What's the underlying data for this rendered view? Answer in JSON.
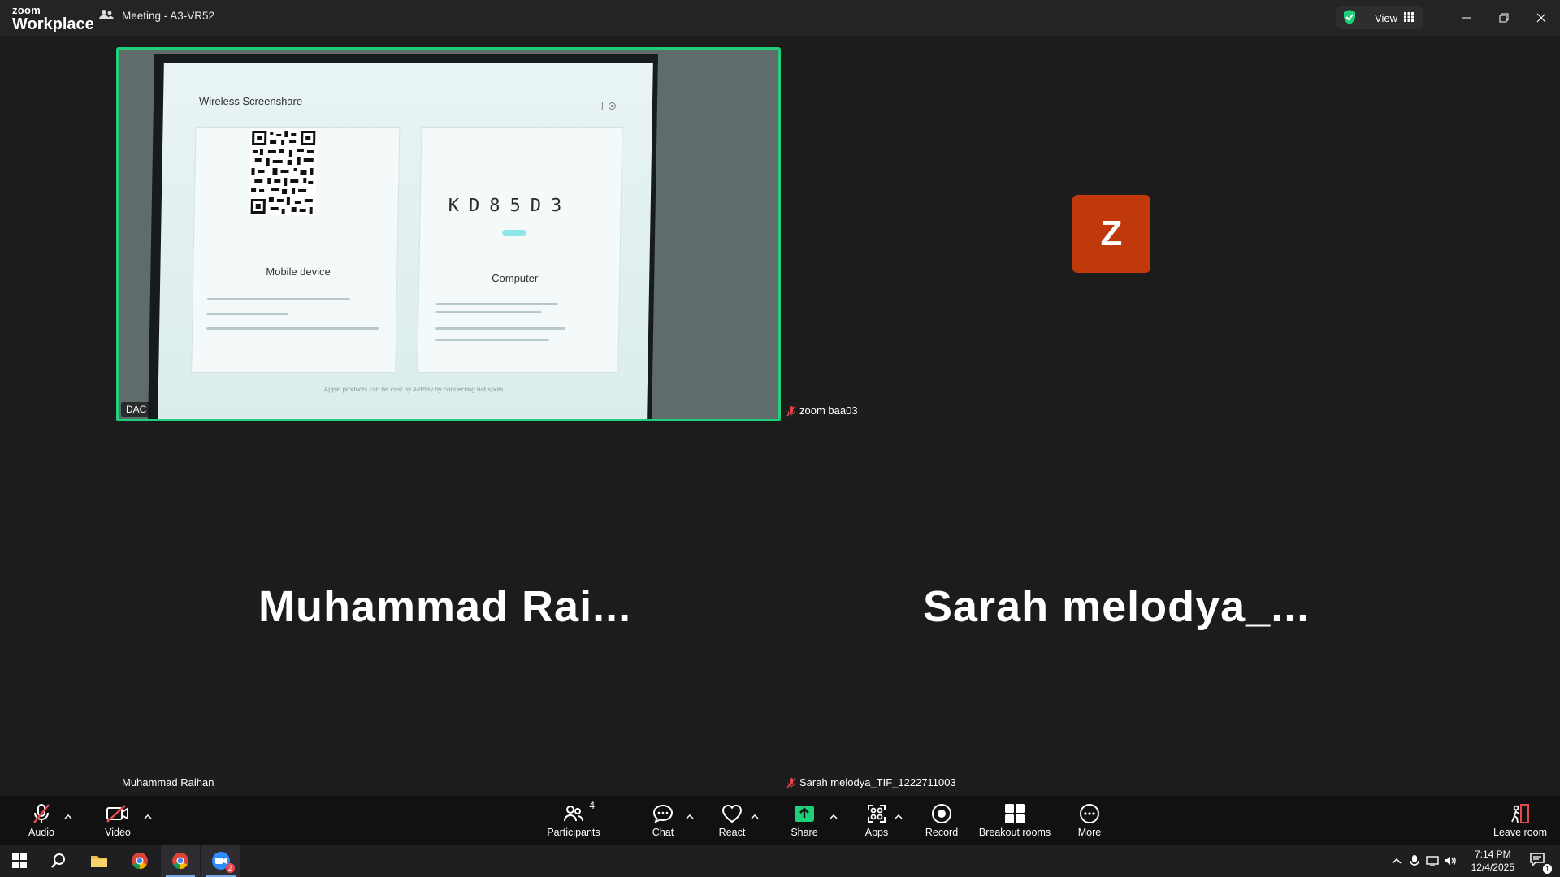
{
  "titlebar": {
    "brand_top": "zoom",
    "brand_bottom": "Workplace",
    "meeting_title": "Meeting - A3-VR52",
    "view_label": "View"
  },
  "video": {
    "participant_label": "DAC",
    "screen": {
      "title": "Wireless Screenshare",
      "code": "KD85D3",
      "mobile_label": "Mobile device",
      "computer_label": "Computer",
      "bottom_note": "Apple products can be cast by AirPlay by connecting hot spots"
    }
  },
  "participants": {
    "zoom_tag": "zoom baa03",
    "avatar_letter": "Z",
    "raihan_big": "Muhammad  Rai...",
    "sarah_big": "Sarah  melodya_...",
    "raihan_tag": "Muhammad Raihan",
    "sarah_tag": "Sarah melodya_TIF_1222711003"
  },
  "toolbar": {
    "audio": "Audio",
    "video": "Video",
    "participants": "Participants",
    "participants_count": "4",
    "chat": "Chat",
    "react": "React",
    "share": "Share",
    "apps": "Apps",
    "record": "Record",
    "breakout": "Breakout rooms",
    "more": "More",
    "leave": "Leave room"
  },
  "taskbar": {
    "time": "7:14 PM",
    "date": "12/4/2025",
    "zoom_badge": "2",
    "notif_badge": "1"
  },
  "colors": {
    "active_speaker_border": "#1ed07a",
    "avatar_bg": "#c0390b",
    "share_green": "#1ed07a",
    "muted_red": "#e5484d"
  }
}
